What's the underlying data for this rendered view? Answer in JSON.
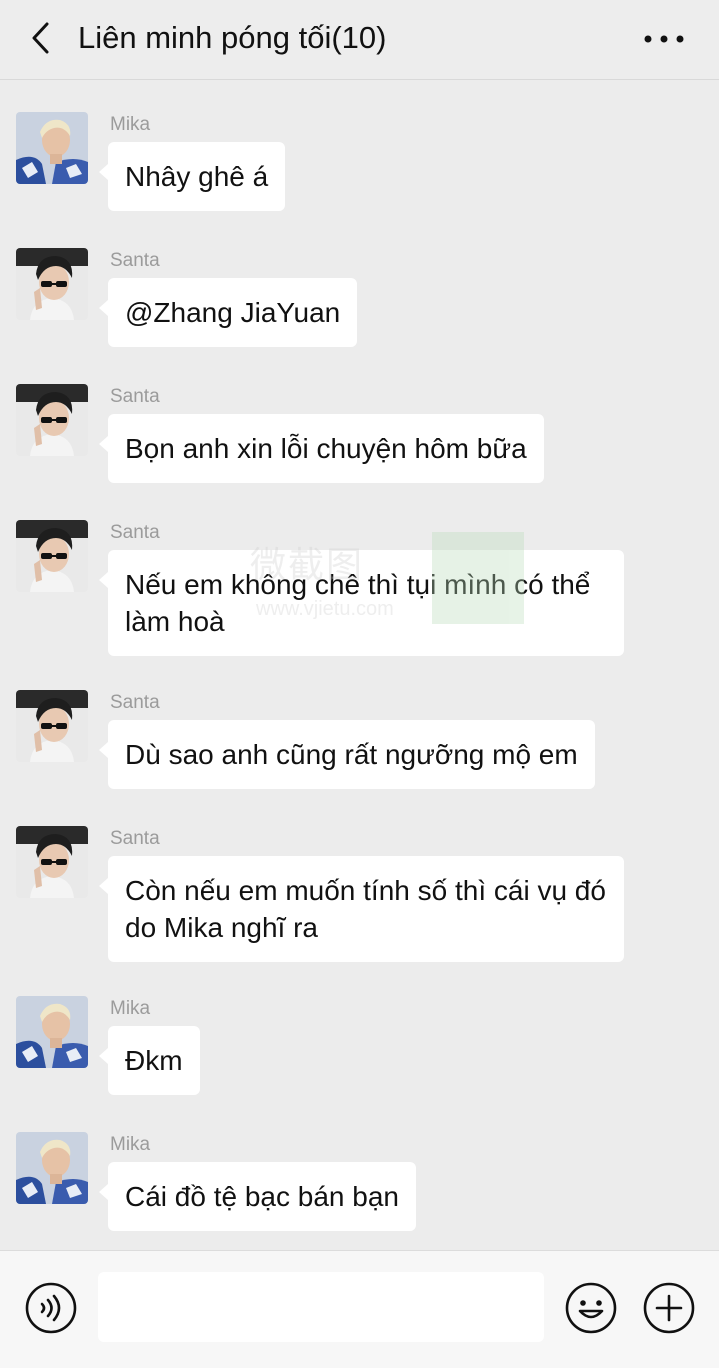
{
  "header": {
    "title": "Liên minh póng tối(10)",
    "back_icon": "chevron-left-icon",
    "more_icon": "more-dots-icon"
  },
  "messages": [
    {
      "sender": "Mika",
      "text": "Nhây ghê á",
      "avatar": "mika"
    },
    {
      "sender": "Santa",
      "text": "@Zhang JiaYuan",
      "avatar": "santa"
    },
    {
      "sender": "Santa",
      "text": "Bọn anh xin lỗi chuyện hôm bữa",
      "avatar": "santa"
    },
    {
      "sender": "Santa",
      "text": "Nếu em không chê thì tụi mình có thể làm hoà",
      "avatar": "santa"
    },
    {
      "sender": "Santa",
      "text": "Dù sao anh cũng rất ngưỡng mộ em",
      "avatar": "santa"
    },
    {
      "sender": "Santa",
      "text": "Còn nếu em muốn tính số thì cái vụ đó do Mika nghĩ ra",
      "avatar": "santa"
    },
    {
      "sender": "Mika",
      "text": "Đkm",
      "avatar": "mika"
    },
    {
      "sender": "Mika",
      "text": "Cái đồ tệ bạc bán bạn",
      "avatar": "mika"
    }
  ],
  "watermark": {
    "text": "微截图",
    "url": "www.vjietu.com"
  },
  "footer": {
    "input_value": "",
    "voice_icon": "voice-icon",
    "emoji_icon": "emoji-icon",
    "plus_icon": "plus-icon"
  },
  "colors": {
    "background": "#ececec",
    "bubble": "#ffffff",
    "sender_name": "#9b9b9b"
  }
}
